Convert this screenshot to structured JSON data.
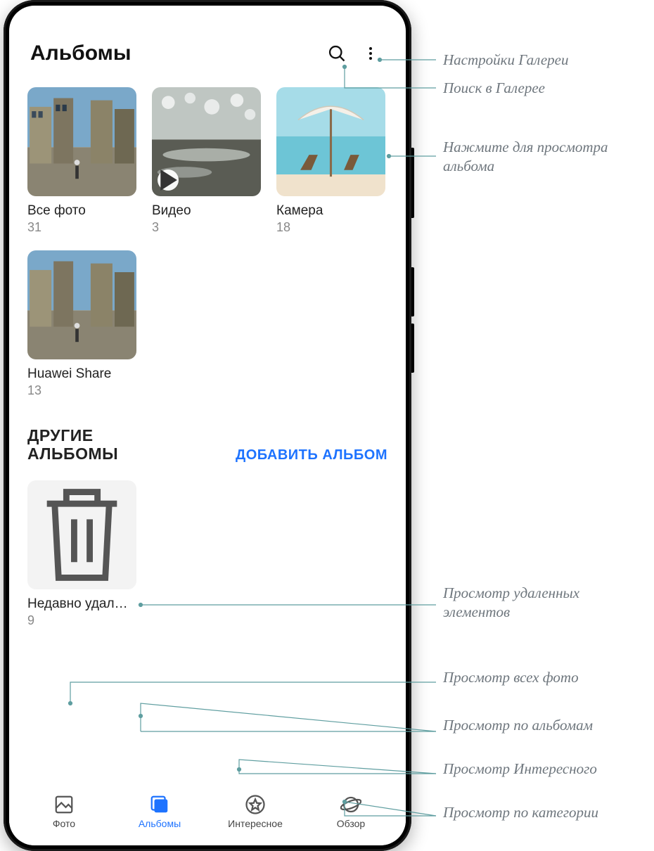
{
  "header": {
    "title": "Альбомы"
  },
  "icons": {
    "search": "search-icon",
    "more": "more-icon"
  },
  "albums": {
    "row1": [
      {
        "name": "Все фото",
        "count": "31"
      },
      {
        "name": "Видео",
        "count": "3"
      },
      {
        "name": "Камера",
        "count": "18"
      }
    ],
    "row2": [
      {
        "name": "Huawei Share",
        "count": "13"
      }
    ]
  },
  "other_section": {
    "title_line1": "ДРУГИЕ",
    "title_line2": "АЛЬБОМЫ",
    "add_label": "ДОБАВИТЬ АЛЬБОМ",
    "trash": {
      "name": "Недавно удал…",
      "count": "9"
    }
  },
  "nav": {
    "items": [
      {
        "label": "Фото"
      },
      {
        "label": "Альбомы"
      },
      {
        "label": "Интересное"
      },
      {
        "label": "Обзор"
      }
    ],
    "active_index": 1
  },
  "callouts": {
    "settings": "Настройки Галереи",
    "search": "Поиск в Галерее",
    "view_album": "Нажмите для просмотра альбома",
    "recently_deleted": "Просмотр удаленных элементов",
    "photos_tab": "Просмотр всех фото",
    "albums_tab": "Просмотр по альбомам",
    "discover_tab": "Просмотр Интересного",
    "browse_tab": "Просмотр по категории"
  },
  "colors": {
    "accent": "#1e73ff",
    "callout_line": "#5f9ea0",
    "text_muted": "#888"
  }
}
